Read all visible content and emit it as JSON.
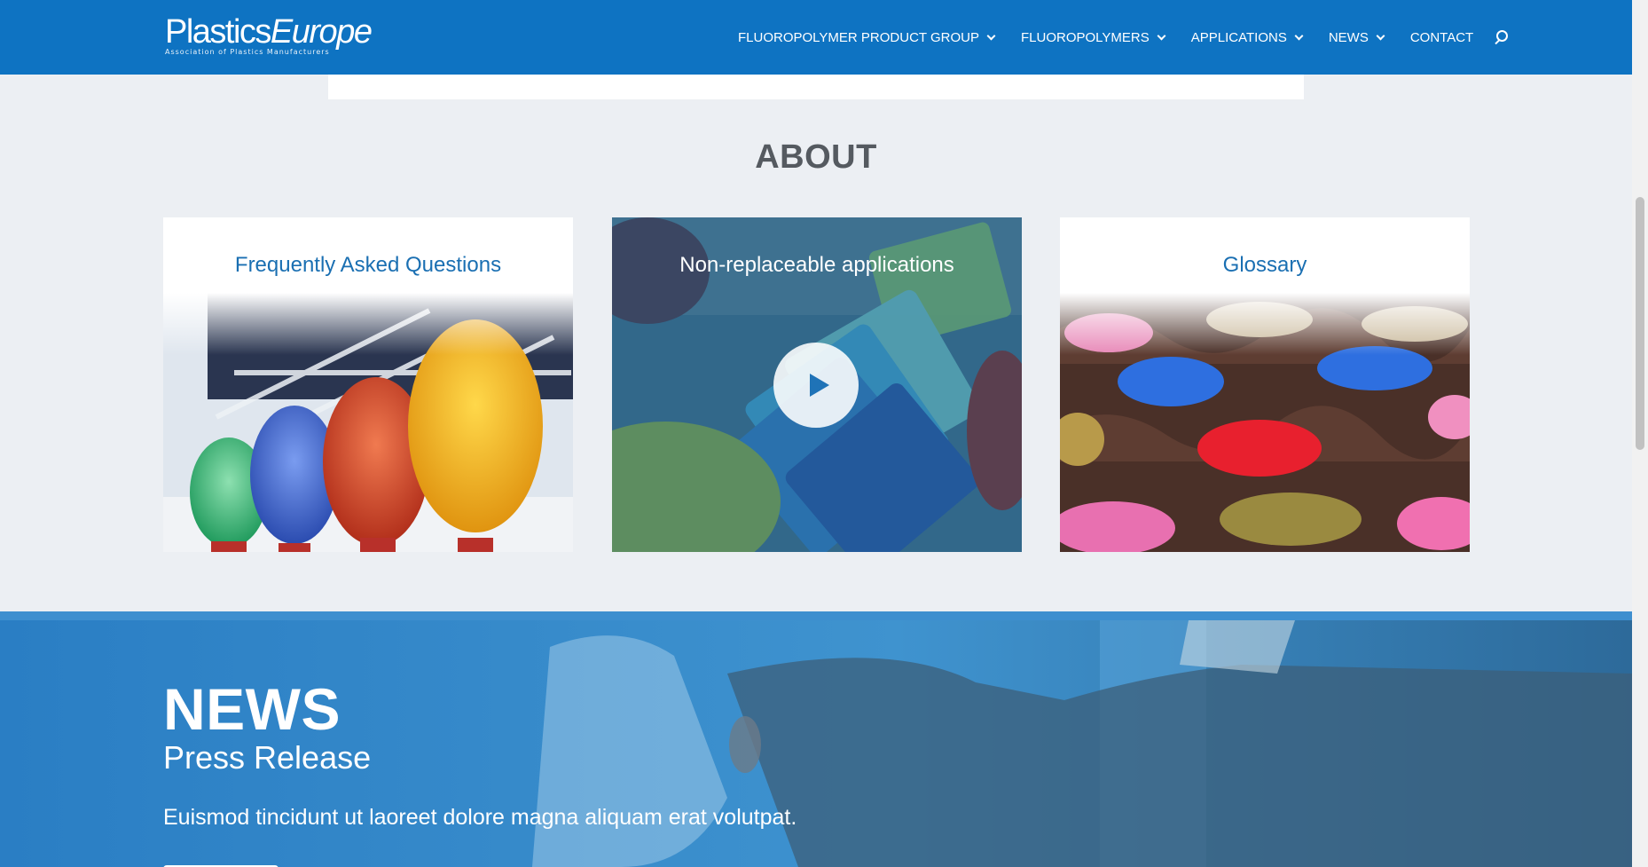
{
  "header": {
    "logo_main_1": "Plastics",
    "logo_main_2": "Europe",
    "logo_sub": "Association of Plastics Manufacturers",
    "nav": [
      {
        "label": "FLUOROPOLYMER PRODUCT GROUP",
        "dropdown": true
      },
      {
        "label": "FLUOROPOLYMERS",
        "dropdown": true
      },
      {
        "label": "APPLICATIONS",
        "dropdown": true
      },
      {
        "label": "NEWS",
        "dropdown": true
      },
      {
        "label": "CONTACT",
        "dropdown": false
      }
    ],
    "search_icon": "search-icon",
    "background": "#0e73c2"
  },
  "about": {
    "title": "ABOUT",
    "cards": [
      {
        "title": "Frequently Asked Questions"
      },
      {
        "title": "Non-replaceable applications",
        "icon": "play-icon"
      },
      {
        "title": "Glossary"
      }
    ]
  },
  "news": {
    "title": "NEWS",
    "subtitle": "Press Release",
    "text": "Euismod tincidunt ut laoreet dolore magna aliquam erat volutpat."
  },
  "colors": {
    "accent": "#1a6fb2",
    "page_bg": "#eceff3",
    "heading": "#555a60"
  }
}
